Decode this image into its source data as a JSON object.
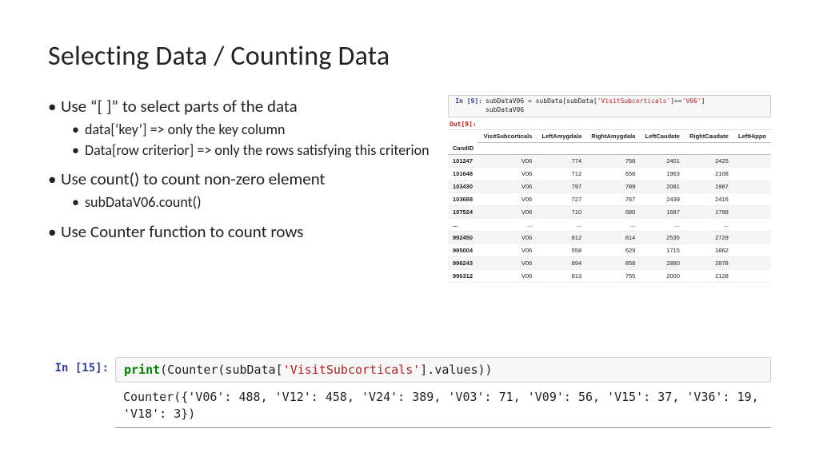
{
  "title": "Selecting Data / Counting Data",
  "bullets": {
    "b1": "Use “[ ]” to select parts of the data",
    "b1a": "data[‘key’]  => only the key column",
    "b1b": "Data[row criterior] => only the rows satisfying this criterion",
    "b2": "Use count() to count non-zero element",
    "b2a": "subDataV06.count()",
    "b3": "Use Counter function to count rows"
  },
  "cell9": {
    "prompt": "In [9]:",
    "line1a": "subDataV06 = subData[subData[",
    "line1b": "'VisitSubcorticals'",
    "line1c": "]==",
    "line1d": "'V06'",
    "line1e": "]",
    "line2": "subDataV06",
    "out_prompt": "Out[9]:"
  },
  "df": {
    "index_name": "CandID",
    "columns": [
      "VisitSubcorticals",
      "LeftAmygdala",
      "RightAmygdala",
      "LeftCaudate",
      "RightCaudate",
      "LeftHippo"
    ],
    "rows": [
      {
        "id": "101247",
        "vals": [
          "V06",
          "774",
          "758",
          "2401",
          "2425",
          ""
        ]
      },
      {
        "id": "101648",
        "vals": [
          "V06",
          "712",
          "658",
          "1963",
          "2108",
          ""
        ]
      },
      {
        "id": "103430",
        "vals": [
          "V06",
          "797",
          "789",
          "2081",
          "1987",
          ""
        ]
      },
      {
        "id": "103688",
        "vals": [
          "V06",
          "727",
          "767",
          "2439",
          "2416",
          ""
        ]
      },
      {
        "id": "107524",
        "vals": [
          "V06",
          "710",
          "680",
          "1687",
          "1798",
          ""
        ]
      },
      {
        "id": "...",
        "vals": [
          "...",
          "...",
          "...",
          "...",
          "...",
          ""
        ]
      },
      {
        "id": "992450",
        "vals": [
          "V06",
          "812",
          "814",
          "2535",
          "2729",
          ""
        ]
      },
      {
        "id": "995004",
        "vals": [
          "V06",
          "558",
          "629",
          "1715",
          "1862",
          ""
        ]
      },
      {
        "id": "996243",
        "vals": [
          "V06",
          "894",
          "858",
          "2880",
          "2878",
          ""
        ]
      },
      {
        "id": "996312",
        "vals": [
          "V06",
          "813",
          "755",
          "2000",
          "2128",
          ""
        ]
      }
    ]
  },
  "cell15": {
    "prompt": "In [15]:",
    "print": "print",
    "code_mid1": "(Counter(subData[",
    "code_str": "'VisitSubcorticals'",
    "code_mid2": "].values))",
    "output": "Counter({'V06': 488, 'V12': 458, 'V24': 389, 'V03': 71, 'V09': 56, 'V15': 37, 'V36': 19, 'V18': 3})"
  }
}
